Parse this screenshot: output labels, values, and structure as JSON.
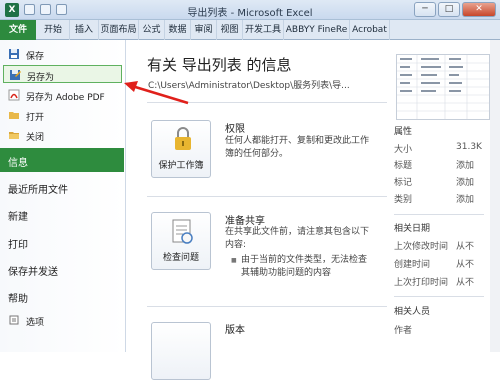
{
  "window": {
    "title": "导出列表 - Microsoft Excel",
    "minimize": "─",
    "maximize": "□",
    "close": "✕",
    "app_icon_letter": "X"
  },
  "ribbon": {
    "tabs": [
      "文件",
      "开始",
      "插入",
      "页面布局",
      "公式",
      "数据",
      "审阅",
      "视图",
      "开发工具",
      "ABBYY FineRe",
      "Acrobat"
    ]
  },
  "sidebar": {
    "save": "保存",
    "save_as": "另存为",
    "save_as_pdf": "另存为 Adobe PDF",
    "open": "打开",
    "close": "关闭",
    "info": "信息",
    "recent": "最近所用文件",
    "new": "新建",
    "print": "打印",
    "save_send": "保存并发送",
    "help": "帮助",
    "options": "选项"
  },
  "main": {
    "title": "有关 导出列表 的信息",
    "path": "C:\\Users\\Administrator\\Desktop\\服务列表\\导...",
    "protect": {
      "button": "保护工作簿",
      "title": "权限",
      "desc": "任何人都能打开、复制和更改此工作簿的任何部分。"
    },
    "check": {
      "button": "检查问题",
      "title": "准备共享",
      "desc": "在共享此文件前，请注意其包含以下内容:",
      "bullet": "由于当前的文件类型，无法检查其辅助功能问题的内容"
    },
    "versions": {
      "title": "版本"
    }
  },
  "properties": {
    "header": "属性",
    "size_label": "大小",
    "size_value": "31.3K",
    "title_label": "标题",
    "title_value": "添加",
    "tags_label": "标记",
    "tags_value": "添加",
    "category_label": "类别",
    "category_value": "添加",
    "dates_header": "相关日期",
    "modified_label": "上次修改时间",
    "modified_value": "从不",
    "created_label": "创建时间",
    "created_value": "从不",
    "printed_label": "上次打印时间",
    "printed_value": "从不",
    "people_header": "相关人员",
    "author_label": "作者"
  },
  "colors": {
    "file_tab": "#2d8a3e",
    "annotation_arrow": "#e0201b",
    "highlight_border": "#5fb15f"
  }
}
